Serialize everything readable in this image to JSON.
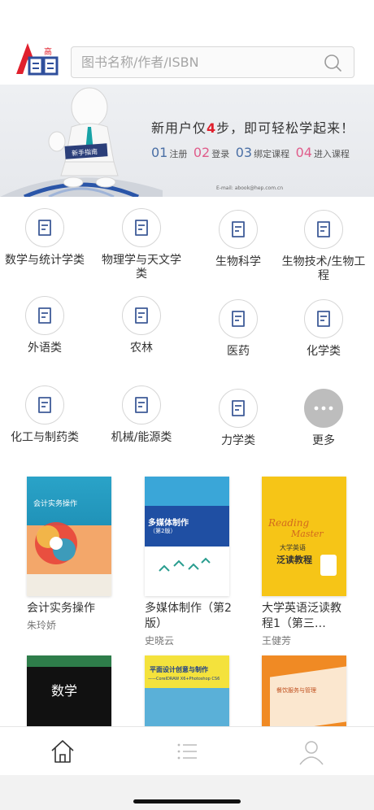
{
  "header": {
    "search_placeholder": "图书名称/作者/ISBN",
    "logo_text": "高"
  },
  "banner": {
    "title_pre": "新用户仅",
    "title_num": "4",
    "title_post": "步，即可轻松学起来！",
    "steps": [
      {
        "num": "01",
        "label": "注册"
      },
      {
        "num": "02",
        "label": "登录"
      },
      {
        "num": "03",
        "label": "绑定课程"
      },
      {
        "num": "04",
        "label": "进入课程"
      }
    ],
    "guide_label": "新手指南",
    "email": "E-mail: abook@hep.com.cn"
  },
  "categories": [
    {
      "label": "数学与统计学类",
      "icon": "book-icon"
    },
    {
      "label": "物理学与天文学类",
      "icon": "book-icon"
    },
    {
      "label": "生物科学",
      "icon": "book-icon"
    },
    {
      "label": "生物技术/生物工程",
      "icon": "book-icon"
    },
    {
      "label": "外语类",
      "icon": "book-icon"
    },
    {
      "label": "农林",
      "icon": "book-icon"
    },
    {
      "label": "医药",
      "icon": "book-icon"
    },
    {
      "label": "化学类",
      "icon": "book-icon"
    },
    {
      "label": "化工与制药类",
      "icon": "book-icon"
    },
    {
      "label": "机械/能源类",
      "icon": "book-icon"
    },
    {
      "label": "力学类",
      "icon": "book-icon"
    },
    {
      "label": "更多",
      "icon": "more-icon"
    }
  ],
  "books": [
    {
      "title": "会计实务操作",
      "author": "朱玲娇",
      "cover_text": "会计实务操作"
    },
    {
      "title": "多媒体制作（第2版）",
      "author": "史晓云",
      "cover_text": "多媒体制作",
      "cover_sub": "（第2版）"
    },
    {
      "title": "大学英语泛读教程1（第三…",
      "author": "王健芳",
      "cover_text": "大学英语",
      "cover_big": "泛读教程",
      "cover_en1": "Reading",
      "cover_en2": "Master"
    },
    {
      "title": "",
      "author": "",
      "cover_text": "数学"
    },
    {
      "title": "",
      "author": "",
      "cover_text": "平面设计创意与制作",
      "cover_sub": "——CorelDRAW X6+Photoshop CS6"
    },
    {
      "title": "",
      "author": "",
      "cover_text": "餐饮服务与管理"
    }
  ],
  "tabbar": {
    "tabs": [
      {
        "name": "home",
        "icon": "home-icon"
      },
      {
        "name": "list",
        "icon": "list-icon"
      },
      {
        "name": "profile",
        "icon": "user-icon"
      }
    ]
  },
  "colors": {
    "accent_red": "#e0202d",
    "accent_blue": "#2f4f9c",
    "icon_blue": "#3e5b98"
  }
}
